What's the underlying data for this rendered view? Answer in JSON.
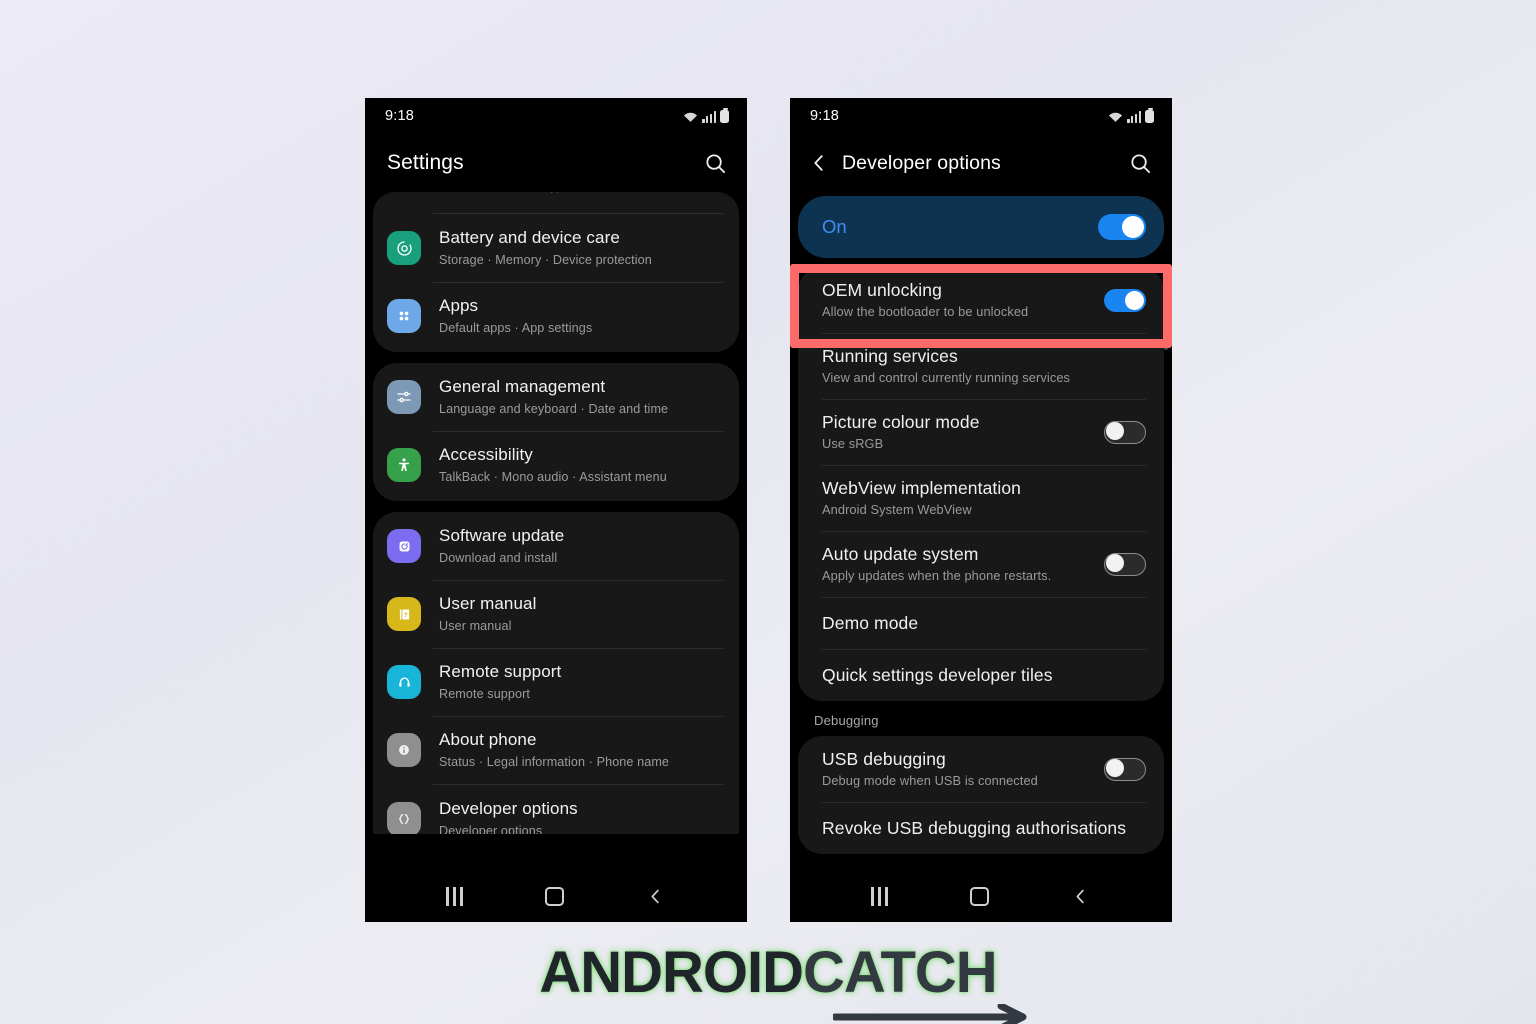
{
  "background": {
    "color_top": "#eceaf4",
    "color_bottom": "#e4e6ee"
  },
  "accent": {
    "highlight_red": "#fc6a6a",
    "toggle_blue": "#1a84f0",
    "banner_blue": "#0d3351",
    "on_text": "#3e8ef7"
  },
  "phone_left": {
    "statusbar": {
      "time": "9:18",
      "icons": [
        "wifi-icon",
        "signal-icon",
        "battery-icon"
      ]
    },
    "appbar": {
      "title": "Settings",
      "search_icon": "search-icon"
    },
    "groups": [
      {
        "partial_top": true,
        "items": [
          {
            "title": "Battery and device care",
            "subtitle": "Storage  ·  Memory  ·  Device protection",
            "icon": "battery-care-icon",
            "icon_color": "#18a07d",
            "highlighted": false
          },
          {
            "title": "Apps",
            "subtitle": "Default apps  ·  App settings",
            "icon": "apps-grid-icon",
            "icon_color": "#6fa8e8",
            "highlighted": false
          }
        ]
      },
      {
        "partial_top": false,
        "items": [
          {
            "title": "General management",
            "subtitle": "Language and keyboard  ·  Date and time",
            "icon": "sliders-icon",
            "icon_color": "#7d99b5",
            "highlighted": false
          },
          {
            "title": "Accessibility",
            "subtitle": "TalkBack  ·  Mono audio  ·  Assistant menu",
            "icon": "accessibility-icon",
            "icon_color": "#37a04a",
            "highlighted": false
          }
        ]
      },
      {
        "partial_top": false,
        "items": [
          {
            "title": "Software update",
            "subtitle": "Download and install",
            "icon": "software-update-icon",
            "icon_color": "#7b6cf0",
            "highlighted": false
          },
          {
            "title": "User manual",
            "subtitle": "User manual",
            "icon": "user-manual-icon",
            "icon_color": "#d6b81b",
            "highlighted": false
          },
          {
            "title": "Remote support",
            "subtitle": "Remote support",
            "icon": "headset-icon",
            "icon_color": "#19b5d8",
            "highlighted": false
          },
          {
            "title": "About phone",
            "subtitle": "Status  ·  Legal information  ·  Phone name",
            "icon": "info-icon",
            "icon_color": "#8f8f8f",
            "highlighted": false
          },
          {
            "title": "Developer options",
            "subtitle": "Developer options",
            "icon": "braces-icon",
            "icon_color": "#8f8f8f",
            "highlighted": true
          }
        ]
      }
    ],
    "navbar": {
      "recents": "recents-icon",
      "home": "home-icon",
      "back": "back-icon"
    }
  },
  "phone_right": {
    "statusbar": {
      "time": "9:18",
      "icons": [
        "wifi-icon",
        "signal-icon",
        "battery-icon"
      ]
    },
    "appbar": {
      "back_icon": "back-chevron-icon",
      "title": "Developer options",
      "search_icon": "search-icon"
    },
    "master_switch": {
      "label": "On",
      "state": "on"
    },
    "items": [
      {
        "title": "OEM unlocking",
        "subtitle": "Allow the bootloader to be unlocked",
        "toggle": "on",
        "highlighted": true
      },
      {
        "title": "Running services",
        "subtitle": "View and control currently running services",
        "toggle": null,
        "highlighted": false
      },
      {
        "title": "Picture colour mode",
        "subtitle": "Use sRGB",
        "toggle": "off",
        "highlighted": false
      },
      {
        "title": "WebView implementation",
        "subtitle": "Android System WebView",
        "toggle": null,
        "highlighted": false
      },
      {
        "title": "Auto update system",
        "subtitle": "Apply updates when the phone restarts.",
        "toggle": "off",
        "highlighted": false
      },
      {
        "title": "Demo mode",
        "subtitle": null,
        "toggle": null,
        "highlighted": false
      },
      {
        "title": "Quick settings developer tiles",
        "subtitle": null,
        "toggle": null,
        "highlighted": false
      }
    ],
    "section_debugging": {
      "label": "Debugging"
    },
    "debug_items": [
      {
        "title": "USB debugging",
        "subtitle": "Debug mode when USB is connected",
        "toggle": "off"
      },
      {
        "title": "Revoke USB debugging authorisations",
        "subtitle": null,
        "toggle": null
      }
    ],
    "navbar": {
      "recents": "recents-icon",
      "home": "home-icon",
      "back": "back-icon"
    }
  },
  "watermark": {
    "part1": "ANDROID",
    "part2": "CATCH",
    "arrow": "arrow-right-icon"
  }
}
